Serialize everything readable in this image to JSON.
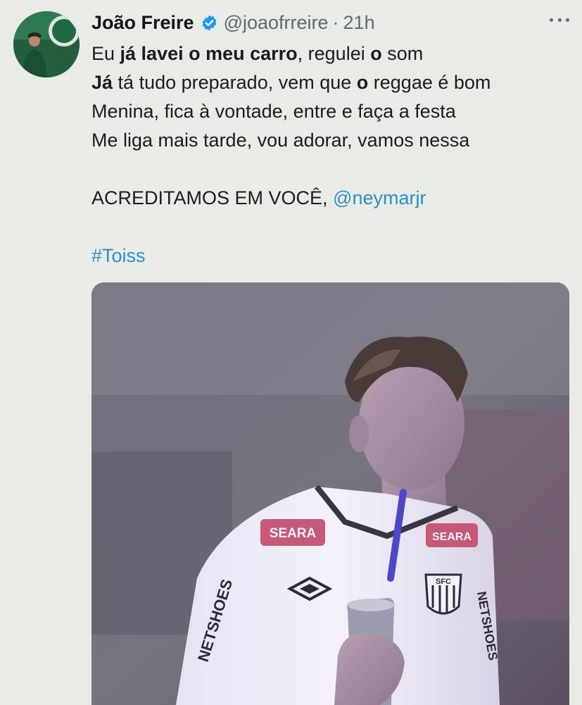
{
  "tweet": {
    "author_name": "João Freire",
    "handle": "@joaofrreire",
    "separator": "·",
    "time": "21h",
    "line1": {
      "a": "Eu ",
      "b": "já lavei o meu carro",
      "c": ", regulei ",
      "d": "o",
      "e": " som"
    },
    "line2": {
      "a": "Já",
      "b": " tá tudo preparado, vem que ",
      "c": "o",
      "d": " reggae é bom"
    },
    "line3": "Menina, fica à vontade, entre e faça a festa",
    "line4": "Me liga mais tarde, vou adorar, vamos nessa",
    "line5": {
      "text": "ACREDITAMOS EM VOCÊ, ",
      "mention": "@neymarjr"
    },
    "hashtag": "#Toiss"
  },
  "media": {
    "sponsor_left": "SEARA",
    "sponsor_right": "SEARA",
    "sleeve_text_left": "NETSHOES",
    "sleeve_text_right": "NETSHOES",
    "crest_text": "SFC"
  },
  "icons": {
    "verified": "verified-badge-icon",
    "more": "more-options-icon"
  },
  "colors": {
    "background": "#e8ebe6",
    "link": "#2f8fc8",
    "verified": "#1d9bf0",
    "secondary_text": "#5f6a72"
  }
}
